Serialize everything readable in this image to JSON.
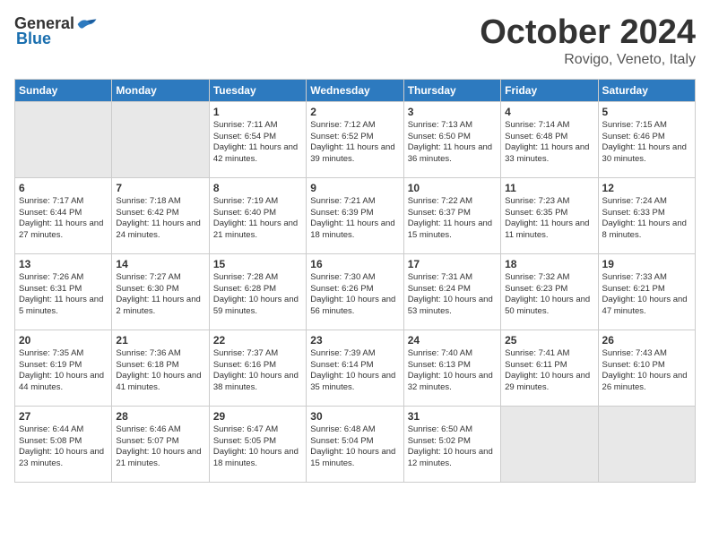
{
  "header": {
    "logo_general": "General",
    "logo_blue": "Blue",
    "month": "October 2024",
    "location": "Rovigo, Veneto, Italy"
  },
  "columns": [
    "Sunday",
    "Monday",
    "Tuesday",
    "Wednesday",
    "Thursday",
    "Friday",
    "Saturday"
  ],
  "weeks": [
    [
      {
        "num": "",
        "empty": true
      },
      {
        "num": "",
        "empty": true
      },
      {
        "num": "1",
        "sunrise": "7:11 AM",
        "sunset": "6:54 PM",
        "daylight": "11 hours and 42 minutes."
      },
      {
        "num": "2",
        "sunrise": "7:12 AM",
        "sunset": "6:52 PM",
        "daylight": "11 hours and 39 minutes."
      },
      {
        "num": "3",
        "sunrise": "7:13 AM",
        "sunset": "6:50 PM",
        "daylight": "11 hours and 36 minutes."
      },
      {
        "num": "4",
        "sunrise": "7:14 AM",
        "sunset": "6:48 PM",
        "daylight": "11 hours and 33 minutes."
      },
      {
        "num": "5",
        "sunrise": "7:15 AM",
        "sunset": "6:46 PM",
        "daylight": "11 hours and 30 minutes."
      }
    ],
    [
      {
        "num": "6",
        "sunrise": "7:17 AM",
        "sunset": "6:44 PM",
        "daylight": "11 hours and 27 minutes."
      },
      {
        "num": "7",
        "sunrise": "7:18 AM",
        "sunset": "6:42 PM",
        "daylight": "11 hours and 24 minutes."
      },
      {
        "num": "8",
        "sunrise": "7:19 AM",
        "sunset": "6:40 PM",
        "daylight": "11 hours and 21 minutes."
      },
      {
        "num": "9",
        "sunrise": "7:21 AM",
        "sunset": "6:39 PM",
        "daylight": "11 hours and 18 minutes."
      },
      {
        "num": "10",
        "sunrise": "7:22 AM",
        "sunset": "6:37 PM",
        "daylight": "11 hours and 15 minutes."
      },
      {
        "num": "11",
        "sunrise": "7:23 AM",
        "sunset": "6:35 PM",
        "daylight": "11 hours and 11 minutes."
      },
      {
        "num": "12",
        "sunrise": "7:24 AM",
        "sunset": "6:33 PM",
        "daylight": "11 hours and 8 minutes."
      }
    ],
    [
      {
        "num": "13",
        "sunrise": "7:26 AM",
        "sunset": "6:31 PM",
        "daylight": "11 hours and 5 minutes."
      },
      {
        "num": "14",
        "sunrise": "7:27 AM",
        "sunset": "6:30 PM",
        "daylight": "11 hours and 2 minutes."
      },
      {
        "num": "15",
        "sunrise": "7:28 AM",
        "sunset": "6:28 PM",
        "daylight": "10 hours and 59 minutes."
      },
      {
        "num": "16",
        "sunrise": "7:30 AM",
        "sunset": "6:26 PM",
        "daylight": "10 hours and 56 minutes."
      },
      {
        "num": "17",
        "sunrise": "7:31 AM",
        "sunset": "6:24 PM",
        "daylight": "10 hours and 53 minutes."
      },
      {
        "num": "18",
        "sunrise": "7:32 AM",
        "sunset": "6:23 PM",
        "daylight": "10 hours and 50 minutes."
      },
      {
        "num": "19",
        "sunrise": "7:33 AM",
        "sunset": "6:21 PM",
        "daylight": "10 hours and 47 minutes."
      }
    ],
    [
      {
        "num": "20",
        "sunrise": "7:35 AM",
        "sunset": "6:19 PM",
        "daylight": "10 hours and 44 minutes."
      },
      {
        "num": "21",
        "sunrise": "7:36 AM",
        "sunset": "6:18 PM",
        "daylight": "10 hours and 41 minutes."
      },
      {
        "num": "22",
        "sunrise": "7:37 AM",
        "sunset": "6:16 PM",
        "daylight": "10 hours and 38 minutes."
      },
      {
        "num": "23",
        "sunrise": "7:39 AM",
        "sunset": "6:14 PM",
        "daylight": "10 hours and 35 minutes."
      },
      {
        "num": "24",
        "sunrise": "7:40 AM",
        "sunset": "6:13 PM",
        "daylight": "10 hours and 32 minutes."
      },
      {
        "num": "25",
        "sunrise": "7:41 AM",
        "sunset": "6:11 PM",
        "daylight": "10 hours and 29 minutes."
      },
      {
        "num": "26",
        "sunrise": "7:43 AM",
        "sunset": "6:10 PM",
        "daylight": "10 hours and 26 minutes."
      }
    ],
    [
      {
        "num": "27",
        "sunrise": "6:44 AM",
        "sunset": "5:08 PM",
        "daylight": "10 hours and 23 minutes."
      },
      {
        "num": "28",
        "sunrise": "6:46 AM",
        "sunset": "5:07 PM",
        "daylight": "10 hours and 21 minutes."
      },
      {
        "num": "29",
        "sunrise": "6:47 AM",
        "sunset": "5:05 PM",
        "daylight": "10 hours and 18 minutes."
      },
      {
        "num": "30",
        "sunrise": "6:48 AM",
        "sunset": "5:04 PM",
        "daylight": "10 hours and 15 minutes."
      },
      {
        "num": "31",
        "sunrise": "6:50 AM",
        "sunset": "5:02 PM",
        "daylight": "10 hours and 12 minutes."
      },
      {
        "num": "",
        "empty": true
      },
      {
        "num": "",
        "empty": true
      }
    ]
  ]
}
